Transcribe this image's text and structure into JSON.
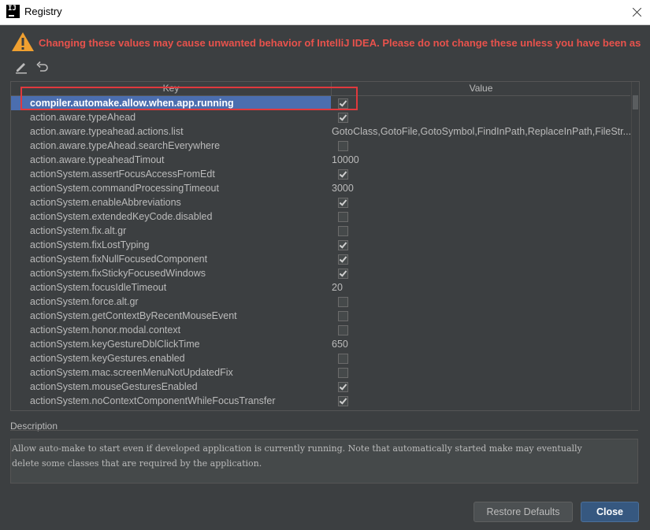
{
  "window": {
    "title": "Registry"
  },
  "warning": {
    "text": "Changing these values may cause unwanted behavior of IntelliJ IDEA. Please do not change these unless you have been ask"
  },
  "toolbar": {
    "edit_icon": "edit-icon",
    "revert_icon": "revert-icon"
  },
  "table": {
    "headers": {
      "key": "Key",
      "value": "Value"
    },
    "rows": [
      {
        "key": "compiler.automake.allow.when.app.running",
        "type": "checkbox",
        "checked": true,
        "selected": true
      },
      {
        "key": "action.aware.typeAhead",
        "type": "checkbox",
        "checked": true
      },
      {
        "key": "action.aware.typeahead.actions.list",
        "type": "text",
        "value": "GotoClass,GotoFile,GotoSymbol,FindInPath,ReplaceInPath,FileStr..."
      },
      {
        "key": "action.aware.typeAhead.searchEverywhere",
        "type": "checkbox",
        "checked": false
      },
      {
        "key": "action.aware.typeaheadTimout",
        "type": "text",
        "value": "10000"
      },
      {
        "key": "actionSystem.assertFocusAccessFromEdt",
        "type": "checkbox",
        "checked": true
      },
      {
        "key": "actionSystem.commandProcessingTimeout",
        "type": "text",
        "value": "3000"
      },
      {
        "key": "actionSystem.enableAbbreviations",
        "type": "checkbox",
        "checked": true
      },
      {
        "key": "actionSystem.extendedKeyCode.disabled",
        "type": "checkbox",
        "checked": false
      },
      {
        "key": "actionSystem.fix.alt.gr",
        "type": "checkbox",
        "checked": false
      },
      {
        "key": "actionSystem.fixLostTyping",
        "type": "checkbox",
        "checked": true
      },
      {
        "key": "actionSystem.fixNullFocusedComponent",
        "type": "checkbox",
        "checked": true
      },
      {
        "key": "actionSystem.fixStickyFocusedWindows",
        "type": "checkbox",
        "checked": true
      },
      {
        "key": "actionSystem.focusIdleTimeout",
        "type": "text",
        "value": "20"
      },
      {
        "key": "actionSystem.force.alt.gr",
        "type": "checkbox",
        "checked": false
      },
      {
        "key": "actionSystem.getContextByRecentMouseEvent",
        "type": "checkbox",
        "checked": false
      },
      {
        "key": "actionSystem.honor.modal.context",
        "type": "checkbox",
        "checked": false
      },
      {
        "key": "actionSystem.keyGestureDblClickTime",
        "type": "text",
        "value": "650"
      },
      {
        "key": "actionSystem.keyGestures.enabled",
        "type": "checkbox",
        "checked": false
      },
      {
        "key": "actionSystem.mac.screenMenuNotUpdatedFix",
        "type": "checkbox",
        "checked": false
      },
      {
        "key": "actionSystem.mouseGesturesEnabled",
        "type": "checkbox",
        "checked": true
      },
      {
        "key": "actionSystem.noContextComponentWhileFocusTransfer",
        "type": "checkbox",
        "checked": true
      },
      {
        "key": "",
        "type": "checkbox",
        "checked": true
      }
    ]
  },
  "description": {
    "title": "Description",
    "lines": [
      "Allow auto-make to start even if developed application is currently running. Note that automatically started make may eventually",
      "delete some classes that are required by the application."
    ]
  },
  "buttons": {
    "restore": "Restore Defaults",
    "close": "Close"
  },
  "colors": {
    "background": "#3c3f41",
    "selection": "#4b6eaf",
    "warning": "#e8524c",
    "highlight_box": "#e0393d"
  }
}
